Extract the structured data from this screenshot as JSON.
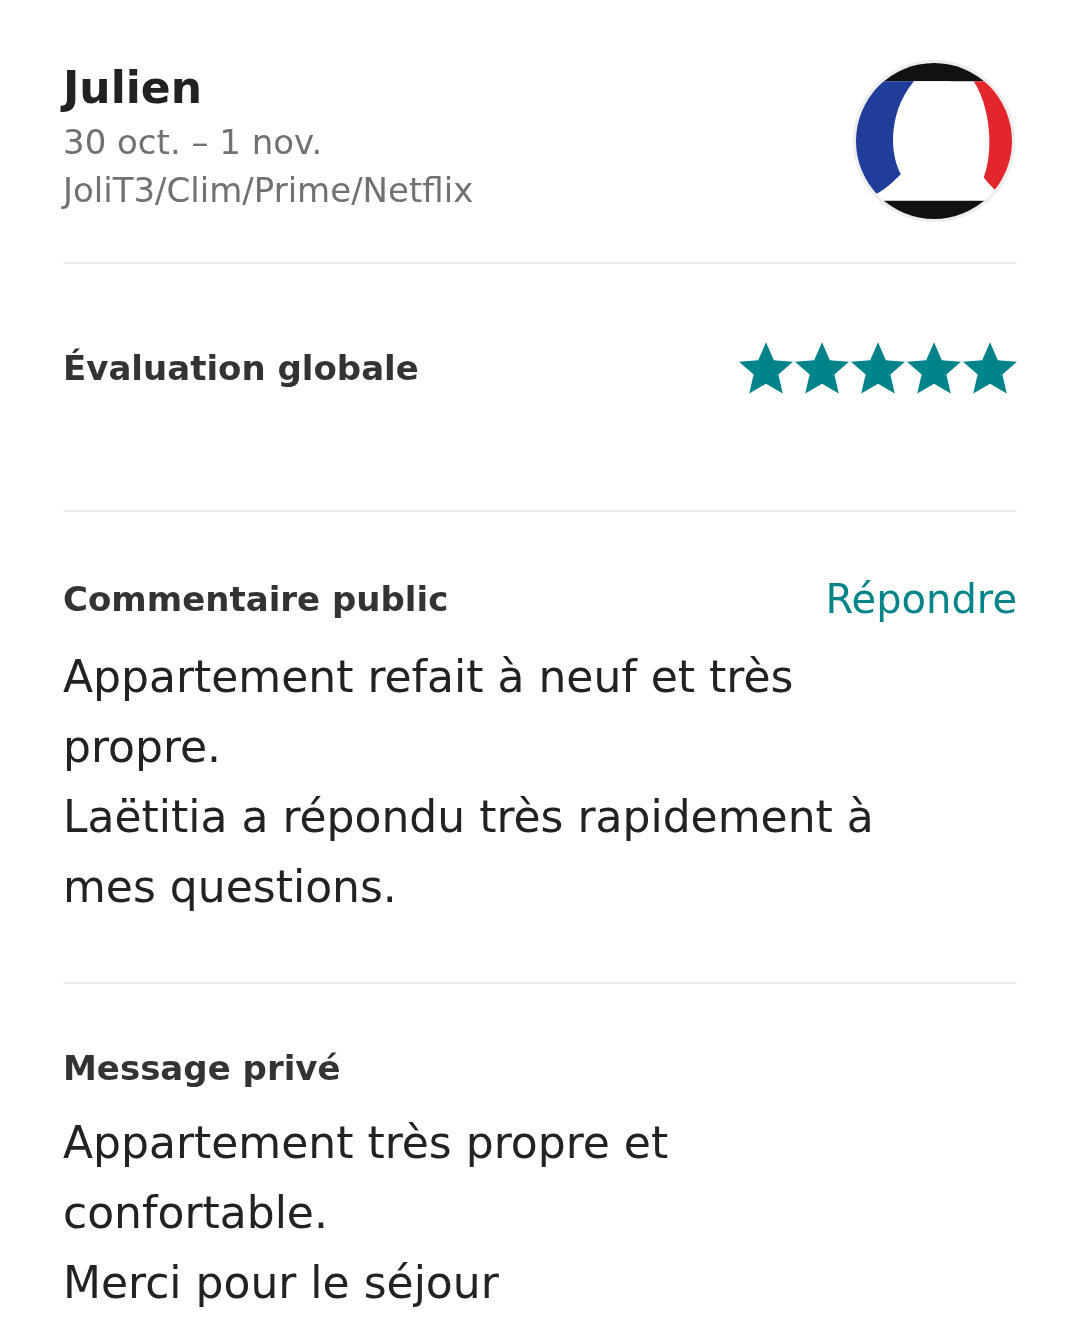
{
  "header": {
    "name": "Julien",
    "dates": "30 oct. – 1 nov.",
    "listing": "JoliT3/Clim/Prime/Netflix"
  },
  "rating": {
    "label": "Évaluation globale",
    "stars": 5
  },
  "public_comment": {
    "label": "Commentaire public",
    "reply": "Répondre",
    "paragraphs": [
      "Appartement refait à neuf et très propre.",
      "Laëtitia a répondu très rapidement à mes questions."
    ]
  },
  "private_message": {
    "label": "Message privé",
    "paragraphs": [
      "Appartement très propre et confortable.",
      "Merci pour le séjour"
    ]
  }
}
